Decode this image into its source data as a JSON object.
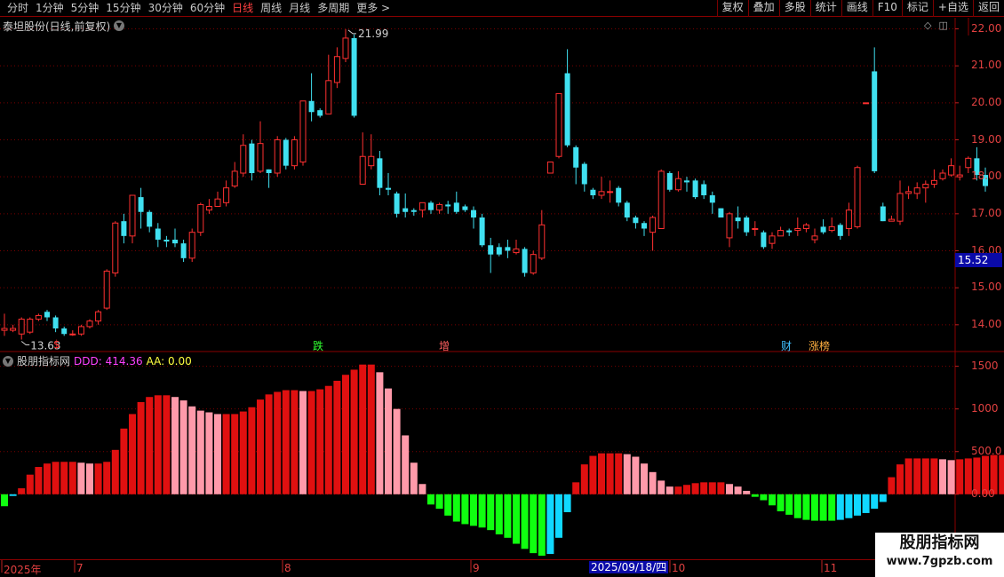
{
  "toolbar": {
    "periods": [
      "分时",
      "1分钟",
      "5分钟",
      "15分钟",
      "30分钟",
      "60分钟",
      "日线",
      "周线",
      "月线",
      "多周期",
      "更多 >"
    ],
    "active_period": "日线",
    "right_buttons": [
      "复权",
      "叠加",
      "多股",
      "统计",
      "画线",
      "F10",
      "标记",
      "+自选",
      "返回"
    ]
  },
  "stock": {
    "title": "泰坦股份(日线,前复权)",
    "current_price": "15.52"
  },
  "main_chart": {
    "price_ticks": [
      "22.00",
      "21.00",
      "20.00",
      "19.00",
      "18.00",
      "17.00",
      "16.00",
      "15.00",
      "14.00"
    ],
    "high_annotation": "21.99",
    "low_annotation": "13.63",
    "events": [
      {
        "label": "$",
        "color": "#ff3030"
      },
      {
        "label": "跌",
        "color": "#30ff30"
      },
      {
        "label": "增",
        "color": "#ff6060"
      },
      {
        "label": "财",
        "color": "#40c0ff"
      },
      {
        "label": "涨榜",
        "color": "#ffb040"
      }
    ]
  },
  "indicator": {
    "name": "股朋指标网",
    "ddd_label": "DDD: 414.36",
    "aa_label": "AA: 0.00",
    "ticks": [
      "1500",
      "1000",
      "500.0",
      "0.00"
    ]
  },
  "date_axis": {
    "labels": [
      "2025年",
      "7",
      "8",
      "9",
      "10",
      "11"
    ],
    "highlight": "2025/09/18/四"
  },
  "watermark": {
    "title": "股朋指标网",
    "url": "www.7gpzb.com"
  },
  "colors": {
    "up": "#ff3030",
    "down": "#40e0f0",
    "bar_red": "#e01010",
    "bar_pink": "#ff9aaa",
    "bar_green": "#10ff10",
    "bar_cyan": "#10d8ff"
  },
  "chart_data": [
    {
      "type": "candlestick",
      "title": "泰坦股份(日线,前复权)",
      "ylim": [
        13.3,
        22.3
      ],
      "candles": [
        [
          13.85,
          13.9,
          13.7,
          14.3
        ],
        [
          13.85,
          13.9,
          13.8,
          14.0
        ],
        [
          13.75,
          14.15,
          13.6,
          14.2
        ],
        [
          13.8,
          14.15,
          13.75,
          14.2
        ],
        [
          14.15,
          14.25,
          14.1,
          14.3
        ],
        [
          14.35,
          14.2,
          14.1,
          14.4
        ],
        [
          14.2,
          13.9,
          13.8,
          14.25
        ],
        [
          13.9,
          13.75,
          13.7,
          13.95
        ],
        [
          13.75,
          13.75,
          13.7,
          13.85
        ],
        [
          13.75,
          13.95,
          13.7,
          14.0
        ],
        [
          13.95,
          14.1,
          13.9,
          14.15
        ],
        [
          14.1,
          14.35,
          14.0,
          14.4
        ],
        [
          14.45,
          15.45,
          14.4,
          15.5
        ],
        [
          15.4,
          16.75,
          15.3,
          16.8
        ],
        [
          16.8,
          16.4,
          16.2,
          17.0
        ],
        [
          16.4,
          17.5,
          16.2,
          17.5
        ],
        [
          17.45,
          17.05,
          16.6,
          17.7
        ],
        [
          17.05,
          16.65,
          16.5,
          17.1
        ],
        [
          16.6,
          16.3,
          16.1,
          16.75
        ],
        [
          16.3,
          16.25,
          16.1,
          16.4
        ],
        [
          16.3,
          16.2,
          16.1,
          16.6
        ],
        [
          16.2,
          15.8,
          15.7,
          16.3
        ],
        [
          15.8,
          16.5,
          15.7,
          16.6
        ],
        [
          16.5,
          17.25,
          16.4,
          17.3
        ],
        [
          17.1,
          17.2,
          17.0,
          17.4
        ],
        [
          17.2,
          17.4,
          17.2,
          17.6
        ],
        [
          17.3,
          17.7,
          17.2,
          17.9
        ],
        [
          17.75,
          18.15,
          17.7,
          18.4
        ],
        [
          18.1,
          18.85,
          18.0,
          19.15
        ],
        [
          18.9,
          18.1,
          17.9,
          19.0
        ],
        [
          18.15,
          18.9,
          18.1,
          19.5
        ],
        [
          18.2,
          18.1,
          17.7,
          18.2
        ],
        [
          18.1,
          19.0,
          18.0,
          19.1
        ],
        [
          19.0,
          18.3,
          18.2,
          19.05
        ],
        [
          18.3,
          19.0,
          18.2,
          19.1
        ],
        [
          18.4,
          20.05,
          18.3,
          20.05
        ],
        [
          20.05,
          19.75,
          19.5,
          20.8
        ],
        [
          19.8,
          19.65,
          19.6,
          19.85
        ],
        [
          19.7,
          20.6,
          19.7,
          21.3
        ],
        [
          20.55,
          21.25,
          20.4,
          21.5
        ],
        [
          21.2,
          21.75,
          21.1,
          21.99
        ],
        [
          21.75,
          19.65,
          19.6,
          21.85
        ],
        [
          17.8,
          18.55,
          17.8,
          19.2
        ],
        [
          18.3,
          18.55,
          18.2,
          19.15
        ],
        [
          18.5,
          17.7,
          17.5,
          18.7
        ],
        [
          17.7,
          17.65,
          17.5,
          18.1
        ],
        [
          17.55,
          17.0,
          16.9,
          17.6
        ],
        [
          17.15,
          17.05,
          16.9,
          17.55
        ],
        [
          17.1,
          17.05,
          16.95,
          17.15
        ],
        [
          17.1,
          17.3,
          16.9,
          17.3
        ],
        [
          17.3,
          17.1,
          17.0,
          17.35
        ],
        [
          17.1,
          17.25,
          17.0,
          17.3
        ],
        [
          17.25,
          17.2,
          17.0,
          17.35
        ],
        [
          17.3,
          17.05,
          17.0,
          17.6
        ],
        [
          17.2,
          17.1,
          17.05,
          17.25
        ],
        [
          17.1,
          16.9,
          16.6,
          17.2
        ],
        [
          16.9,
          16.15,
          16.1,
          17.0
        ],
        [
          16.15,
          15.9,
          15.4,
          16.35
        ],
        [
          16.1,
          15.9,
          15.85,
          16.2
        ],
        [
          16.1,
          16.0,
          15.8,
          16.3
        ],
        [
          15.95,
          16.05,
          15.9,
          16.3
        ],
        [
          16.05,
          15.4,
          15.3,
          16.1
        ],
        [
          15.4,
          15.9,
          15.35,
          16.0
        ],
        [
          15.8,
          16.7,
          15.75,
          17.1
        ],
        [
          18.1,
          18.4,
          18.1,
          18.4
        ],
        [
          18.55,
          20.25,
          18.5,
          20.25
        ],
        [
          20.8,
          18.85,
          18.8,
          21.45
        ],
        [
          18.8,
          18.25,
          17.8,
          18.85
        ],
        [
          18.35,
          17.8,
          17.6,
          18.4
        ],
        [
          17.65,
          17.5,
          17.4,
          17.7
        ],
        [
          17.5,
          17.6,
          17.4,
          18.0
        ],
        [
          17.6,
          17.6,
          17.3,
          17.9
        ],
        [
          17.7,
          17.3,
          17.2,
          17.75
        ],
        [
          17.3,
          16.9,
          16.8,
          17.35
        ],
        [
          16.9,
          16.75,
          16.6,
          16.95
        ],
        [
          16.75,
          16.6,
          16.4,
          16.8
        ],
        [
          16.5,
          16.9,
          16.0,
          16.95
        ],
        [
          16.6,
          18.15,
          16.6,
          18.2
        ],
        [
          18.1,
          17.65,
          17.6,
          18.15
        ],
        [
          17.65,
          17.95,
          17.6,
          18.15
        ],
        [
          17.9,
          17.85,
          17.6,
          18.0
        ],
        [
          17.9,
          17.45,
          17.4,
          17.95
        ],
        [
          17.8,
          17.5,
          17.4,
          17.9
        ],
        [
          17.5,
          17.3,
          17.0,
          17.6
        ],
        [
          17.15,
          16.9,
          16.9,
          17.15
        ],
        [
          16.35,
          17.0,
          16.1,
          17.05
        ],
        [
          16.9,
          16.8,
          16.6,
          17.2
        ],
        [
          16.9,
          16.5,
          16.4,
          16.95
        ],
        [
          16.6,
          16.6,
          16.4,
          16.8
        ],
        [
          16.5,
          16.1,
          16.05,
          16.55
        ],
        [
          16.2,
          16.4,
          16.05,
          16.5
        ],
        [
          16.4,
          16.55,
          16.4,
          16.65
        ],
        [
          16.55,
          16.5,
          16.4,
          16.6
        ],
        [
          16.55,
          16.6,
          16.4,
          16.9
        ],
        [
          16.6,
          16.7,
          16.5,
          16.75
        ],
        [
          16.3,
          16.4,
          16.2,
          16.6
        ],
        [
          16.65,
          16.5,
          16.45,
          16.85
        ],
        [
          16.55,
          16.65,
          16.5,
          16.9
        ],
        [
          16.7,
          16.4,
          16.3,
          16.75
        ],
        [
          16.6,
          17.1,
          16.4,
          17.3
        ],
        [
          16.65,
          18.25,
          16.6,
          18.3
        ],
        [
          20.0,
          20.0,
          20.0,
          20.0
        ],
        [
          20.85,
          18.15,
          18.1,
          21.5
        ],
        [
          17.2,
          16.8,
          16.8,
          17.3
        ],
        [
          16.8,
          16.85,
          16.8,
          16.95
        ],
        [
          16.8,
          17.55,
          16.7,
          17.9
        ],
        [
          17.55,
          17.6,
          17.4,
          17.75
        ],
        [
          17.55,
          17.7,
          17.4,
          17.85
        ],
        [
          17.7,
          17.8,
          17.3,
          17.9
        ],
        [
          17.8,
          17.9,
          17.7,
          18.2
        ],
        [
          17.95,
          18.1,
          17.9,
          18.2
        ],
        [
          18.05,
          18.3,
          18.0,
          18.5
        ],
        [
          18.0,
          18.05,
          17.9,
          18.3
        ],
        [
          18.25,
          18.5,
          18.1,
          18.55
        ],
        [
          18.5,
          18.05,
          17.9,
          18.8
        ],
        [
          18.05,
          17.75,
          17.6,
          18.25
        ]
      ]
    },
    {
      "type": "bar",
      "title": "股朋指标网",
      "ylim": [
        -720,
        1600
      ],
      "values": [
        -140,
        -20,
        70,
        230,
        320,
        360,
        380,
        380,
        380,
        370,
        360,
        360,
        380,
        520,
        770,
        940,
        1080,
        1140,
        1160,
        1160,
        1140,
        1100,
        1030,
        980,
        960,
        940,
        940,
        940,
        970,
        1020,
        1110,
        1170,
        1200,
        1220,
        1220,
        1210,
        1210,
        1230,
        1270,
        1330,
        1400,
        1460,
        1520,
        1520,
        1430,
        1240,
        1000,
        690,
        370,
        120,
        -120,
        -170,
        -250,
        -320,
        -350,
        -370,
        -390,
        -420,
        -470,
        -510,
        -580,
        -640,
        -690,
        -720,
        -700,
        -510,
        -210,
        140,
        350,
        450,
        480,
        480,
        480,
        470,
        440,
        360,
        260,
        160,
        90,
        90,
        110,
        130,
        140,
        140,
        140,
        120,
        90,
        40,
        -30,
        -70,
        -130,
        -200,
        -240,
        -280,
        -300,
        -310,
        -310,
        -310,
        -300,
        -280,
        -250,
        -220,
        -170,
        -90,
        200,
        350,
        420,
        420,
        420,
        420,
        410,
        400,
        410,
        420,
        430,
        450,
        460,
        460,
        450,
        440
      ]
    }
  ]
}
